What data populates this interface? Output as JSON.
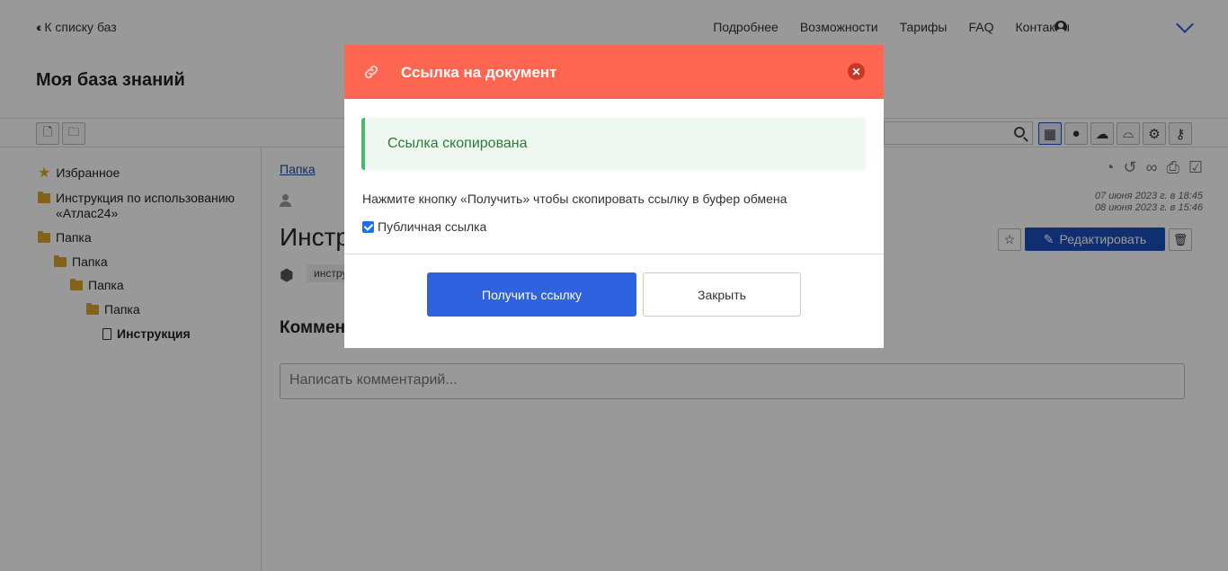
{
  "header": {
    "back_label": "К списку баз",
    "nav": [
      "Подробнее",
      "Возможности",
      "Тарифы",
      "FAQ",
      "Контакты"
    ]
  },
  "kb_title": "Моя база знаний",
  "sidebar": {
    "items": [
      {
        "label": "Избранное",
        "icon": "star-icon"
      },
      {
        "label": "Инструкция по использованию «Атлас24»",
        "icon": "folder-icon"
      },
      {
        "label": "Папка",
        "icon": "folder-open-icon"
      },
      {
        "label": "Папка",
        "icon": "folder-open-icon"
      },
      {
        "label": "Папка",
        "icon": "folder-open-icon"
      },
      {
        "label": "Папка",
        "icon": "folder-open-icon"
      },
      {
        "label": "Инструкция",
        "icon": "document-icon"
      }
    ]
  },
  "main": {
    "breadcrumb": "Папка",
    "title_visible": "Инстр",
    "tag": "инстру",
    "comments_title": "Коммен",
    "comment_placeholder": "Написать комментарий...",
    "date_created": "07 июня 2023 г. в 18:45",
    "date_modified": "08 июня 2023 г. в 15:46",
    "edit_label": "Редактировать"
  },
  "modal": {
    "title": "Ссылка на документ",
    "alert": "Ссылка скопирована",
    "hint": "Нажмите кнопку «Получить» чтобы скопировать ссылку в буфер обмена",
    "checkbox_label": "Публичная ссылка",
    "checkbox_checked": true,
    "get_button": "Получить ссылку",
    "close_button": "Закрыть"
  },
  "colors": {
    "modal_header": "#ff6652",
    "primary_button": "#2e62de",
    "alert_bg": "#eef8f0",
    "alert_text": "#2d7a3e"
  }
}
